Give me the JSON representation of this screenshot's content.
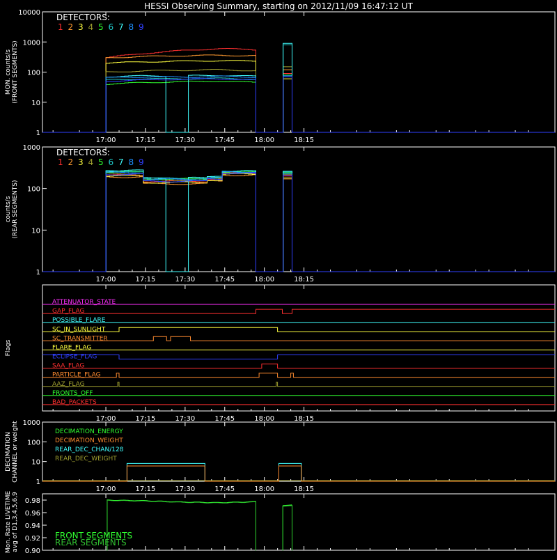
{
  "title": "HESSI Observing Summary, starting on 2012/11/09 16:47:12 UT",
  "colors": {
    "bg": "#000000",
    "axis": "#ffffff",
    "det": [
      "#ff3030",
      "#ff9a30",
      "#ffff40",
      "#a0a030",
      "#30ff30",
      "#20c8c8",
      "#40ffff",
      "#1e90ff",
      "#3040ff"
    ],
    "magenta": "#ff30ff",
    "red": "#ff3030",
    "cyan": "#40ffff",
    "yellow": "#ffff40",
    "orange": "#ff8c30",
    "blue": "#3040ff",
    "olive": "#a0a030",
    "green": "#30ff30",
    "green2": "#30c030"
  },
  "x_axis": {
    "range_min": [
      996,
      1190
    ],
    "ticks_min": [
      1020,
      1035,
      1050,
      1065,
      1080,
      1095
    ],
    "tick_labels": [
      "17:00",
      "17:15",
      "17:30",
      "17:45",
      "18:00",
      "18:15"
    ]
  },
  "detectors": {
    "title": "DETECTORS:",
    "numbers": [
      "1",
      "2",
      "3",
      "4",
      "5",
      "6",
      "7",
      "8",
      "9"
    ]
  },
  "chart_data": [
    {
      "type": "line",
      "name": "front",
      "ylabel": [
        "MON. counts/s",
        "(FRONT SEGMENTS)"
      ],
      "ylog": true,
      "ylim": [
        1,
        10000
      ],
      "ytick_labels": [
        "1",
        "10",
        "100",
        "1000",
        "10000"
      ],
      "ytick_values": [
        1,
        10,
        100,
        1000,
        10000
      ],
      "segments": [
        [
          1020,
          1076.8
        ],
        [
          1086.8,
          1090.5
        ]
      ],
      "series": [
        {
          "c": 0,
          "lv": [
            300,
            420,
            520,
            600,
            550
          ],
          "l2": 90
        },
        {
          "c": 1,
          "lv": [
            300,
            330,
            350,
            360,
            350
          ],
          "l2": 120
        },
        {
          "c": 2,
          "lv": [
            200,
            220,
            230,
            240,
            230
          ],
          "l2": 60
        },
        {
          "c": 3,
          "lv": [
            100,
            110,
            115,
            120,
            110
          ],
          "l2": 150
        },
        {
          "c": 4,
          "lv": [
            40,
            45,
            48,
            50,
            45
          ],
          "l2": 80
        },
        {
          "c": 5,
          "lv": [
            55,
            60,
            60,
            62,
            58
          ],
          "l2": 800
        },
        {
          "c": 6,
          "lv": [
            70,
            75,
            75,
            78,
            72
          ],
          "l2": 900
        },
        {
          "c": 7,
          "lv": [
            65,
            70,
            68,
            72,
            68
          ],
          "l2": 75
        },
        {
          "c": 8,
          "lv": [
            50,
            55,
            58,
            60,
            55
          ],
          "l2": 70
        }
      ],
      "dips": [
        {
          "c": 6,
          "start": 1042.5,
          "end": 1051
        }
      ]
    },
    {
      "type": "line",
      "name": "rear",
      "ylabel": [
        "counts/s",
        "(REAR SEGMENTS)"
      ],
      "ylog": true,
      "ylim": [
        1,
        1000
      ],
      "ytick_labels": [
        "1",
        "10",
        "100",
        "1000"
      ],
      "ytick_values": [
        1,
        10,
        100,
        1000
      ],
      "segments": [
        [
          1020,
          1076.8
        ],
        [
          1086.8,
          1090.5
        ]
      ],
      "series": [
        {
          "c": 0,
          "lv": [
            210,
            150,
            170,
            230
          ],
          "l2": 200
        },
        {
          "c": 1,
          "lv": [
            190,
            130,
            150,
            210
          ],
          "l2": 170
        },
        {
          "c": 2,
          "lv": [
            200,
            140,
            160,
            220
          ],
          "l2": 180
        },
        {
          "c": 3,
          "lv": [
            230,
            160,
            175,
            240
          ],
          "l2": 220
        },
        {
          "c": 4,
          "lv": [
            250,
            170,
            185,
            250
          ],
          "l2": 240
        },
        {
          "c": 5,
          "lv": [
            260,
            175,
            190,
            255
          ],
          "l2": 250
        },
        {
          "c": 6,
          "lv": [
            270,
            180,
            195,
            260
          ],
          "l2": 260
        },
        {
          "c": 7,
          "lv": [
            240,
            165,
            180,
            245
          ],
          "l2": 230
        },
        {
          "c": 8,
          "lv": [
            220,
            150,
            170,
            235
          ],
          "l2": 210
        }
      ],
      "level_breaks": [
        1020,
        1033,
        1057.5,
        1064,
        1076.8
      ],
      "dips": [
        {
          "c": 6,
          "start": 1042.5,
          "end": 1051
        }
      ]
    },
    {
      "type": "flags",
      "name": "flags",
      "ylabel": "Flags",
      "rows": [
        {
          "label": "ATTENUATOR_STATE",
          "color": "#ff30ff",
          "steps": [
            [
              996,
              0
            ]
          ]
        },
        {
          "label": "GAP_FLAG",
          "color": "#ff3030",
          "steps": [
            [
              996,
              0
            ],
            [
              1076.8,
              1
            ],
            [
              1086.8,
              0
            ],
            [
              1090.5,
              1
            ]
          ]
        },
        {
          "label": "POSSIBLE_FLARE",
          "color": "#40ffff",
          "steps": [
            [
              996,
              0
            ]
          ]
        },
        {
          "label": "SC_IN_SUNLIGHT",
          "color": "#ffff40",
          "steps": [
            [
              996,
              0
            ],
            [
              1025,
              1
            ],
            [
              1085,
              0
            ]
          ]
        },
        {
          "label": "SC_TRANSMITTER",
          "color": "#ff8c30",
          "steps": [
            [
              996,
              0
            ],
            [
              1038,
              1
            ],
            [
              1043,
              0
            ],
            [
              1044.5,
              1
            ],
            [
              1052,
              0
            ]
          ]
        },
        {
          "label": "FLARE_FLAG",
          "color": "#ffff40",
          "steps": [
            [
              996,
              0
            ]
          ]
        },
        {
          "label": "ECLIPSE_FLAG",
          "color": "#3040ff",
          "steps": [
            [
              996,
              1
            ],
            [
              1025,
              0
            ],
            [
              1085,
              1
            ]
          ]
        },
        {
          "label": "SAA_FLAG",
          "color": "#ff3030",
          "steps": [
            [
              996,
              0
            ],
            [
              1079,
              1
            ],
            [
              1085,
              0
            ]
          ]
        },
        {
          "label": "PARTICLE_FLAG",
          "color": "#ff8c30",
          "steps": [
            [
              996,
              0
            ],
            [
              1024,
              1
            ],
            [
              1025,
              0
            ],
            [
              1078,
              1
            ],
            [
              1085,
              0
            ],
            [
              1090,
              1
            ],
            [
              1091,
              0
            ]
          ]
        },
        {
          "label": "AAZ_FLAG",
          "color": "#a0a030",
          "steps": [
            [
              996,
              0
            ],
            [
              1024.5,
              1
            ],
            [
              1025,
              0
            ],
            [
              1084.5,
              1
            ],
            [
              1085,
              0
            ]
          ]
        },
        {
          "label": "FRONTS_OFF",
          "color": "#30ff30",
          "steps": [
            [
              996,
              0
            ]
          ]
        },
        {
          "label": "BAD_PACKETS",
          "color": "#ff3030",
          "steps": [
            [
              996,
              0
            ]
          ]
        }
      ]
    },
    {
      "type": "line",
      "name": "decimation",
      "ylabel": [
        "DECIMATION",
        "CHANNEL or weight"
      ],
      "ylog": true,
      "ylim": [
        1,
        1000
      ],
      "ytick_labels": [
        "1",
        "10",
        "100",
        "1000"
      ],
      "ytick_values": [
        1,
        10,
        100,
        1000
      ],
      "legend": [
        {
          "label": "DECIMATION_ENERGY",
          "color": "#30ff30"
        },
        {
          "label": "DECIMATION_WEIGHT",
          "color": "#ff8c30"
        },
        {
          "label": "REAR_DEC_CHAN/128",
          "color": "#40ffff"
        },
        {
          "label": "REAR_DEC_WEIGHT",
          "color": "#a0a030"
        }
      ],
      "series": [
        {
          "label": "REAR_DEC_CHAN/128",
          "color": "#40ffff",
          "steps": [
            [
              1028,
              8
            ],
            [
              1057.5,
              1
            ],
            [
              1085.5,
              8
            ],
            [
              1094,
              1
            ]
          ]
        },
        {
          "label": "DECIMATION_WEIGHT",
          "color": "#ff8c30",
          "steps": [
            [
              1028,
              6
            ],
            [
              1057.5,
              1
            ],
            [
              1085.5,
              6
            ],
            [
              1094,
              1
            ]
          ]
        }
      ]
    },
    {
      "type": "line",
      "name": "livetime",
      "ylabel": [
        "Mon. Rate LIVETIME",
        "avg of D1,3,4,5,6,9"
      ],
      "ylim": [
        0.9,
        0.99
      ],
      "ytick_labels": [
        "0.90",
        "0.92",
        "0.94",
        "0.96",
        "0.98"
      ],
      "ytick_values": [
        0.9,
        0.92,
        0.94,
        0.96,
        0.98
      ],
      "legend": [
        {
          "label": "FRONT SEGMENTS",
          "color": "#30ff30"
        },
        {
          "label": "REAR SEGMENTS",
          "color": "#30c030"
        }
      ],
      "segments": [
        {
          "start": 1020.5,
          "end": 1076.8,
          "values": [
            0.98,
            0.979,
            0.977,
            0.976,
            0.9775
          ]
        },
        {
          "start": 1087,
          "end": 1090.5,
          "values": [
            0.971,
            0.972
          ]
        }
      ]
    }
  ]
}
